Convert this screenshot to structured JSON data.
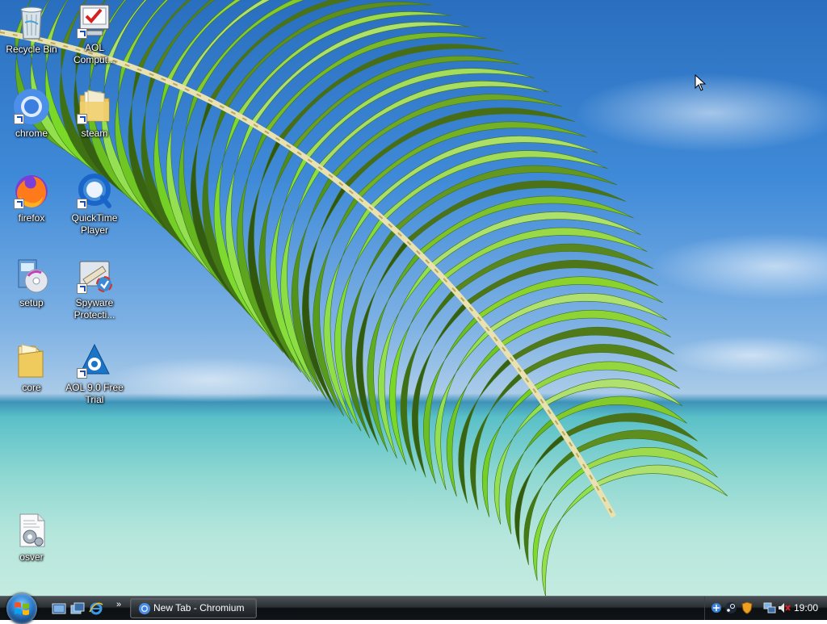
{
  "desktop": {
    "icons": [
      {
        "label": "Recycle Bin",
        "icon": "recycle-bin-icon"
      },
      {
        "label": "AOL Comput...",
        "icon": "aol-computer-checkup-icon"
      },
      {
        "label": "chrome",
        "icon": "chrome-icon"
      },
      {
        "label": "steam",
        "icon": "folder-icon"
      },
      {
        "label": "firefox",
        "icon": "firefox-icon"
      },
      {
        "label": "QuickTime Player",
        "icon": "quicktime-icon"
      },
      {
        "label": "setup",
        "icon": "setup-icon"
      },
      {
        "label": "Spyware Protecti...",
        "icon": "spyware-protection-icon"
      },
      {
        "label": "core",
        "icon": "folder-icon"
      },
      {
        "label": "AOL 9.0 Free Trial",
        "icon": "aol-icon"
      },
      {
        "label": "osver",
        "icon": "document-gear-icon"
      }
    ]
  },
  "taskbar": {
    "start": "start-orb-icon",
    "quick_launch": [
      "show-desktop-icon",
      "switch-windows-icon",
      "internet-explorer-icon"
    ],
    "tasks": [
      {
        "label": "New Tab - Chromium",
        "icon": "chromium-icon"
      }
    ],
    "tray_icons": [
      "network-status-icon",
      "steam-tray-icon",
      "security-shield-icon",
      "network-icon",
      "volume-muted-icon"
    ],
    "clock": "19:00"
  },
  "colors": {
    "label_text": "#ffffff",
    "taskbar": "#1b1f22",
    "accent": "#2f7fd0"
  }
}
